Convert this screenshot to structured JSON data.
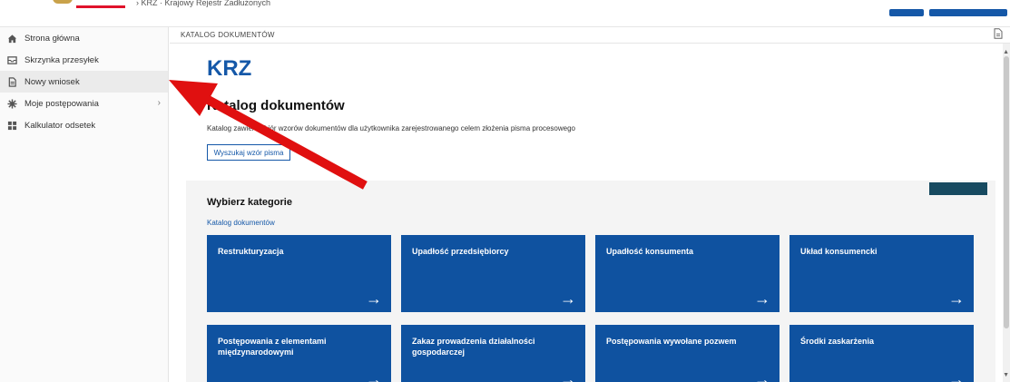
{
  "header": {
    "breadcrumb": "›  KRZ · Krajowy Rejestr Zadłużonych"
  },
  "sidebar": {
    "items": [
      {
        "label": "Strona główna",
        "icon": "home-icon"
      },
      {
        "label": "Skrzynka przesyłek",
        "icon": "inbox-icon"
      },
      {
        "label": "Nowy wniosek",
        "icon": "document-icon"
      },
      {
        "label": "Moje postępowania",
        "icon": "gear-icon"
      },
      {
        "label": "Kalkulator odsetek",
        "icon": "calculator-icon"
      }
    ]
  },
  "page": {
    "breadcrumb": "KATALOG DOKUMENTÓW",
    "brand": "KRZ",
    "title": "Katalog dokumentów",
    "description": "Katalog zawiera zbiór wzorów dokumentów dla użytkownika zarejestrowanego celem złożenia pisma procesowego",
    "search_button": "Wyszukaj wzór pisma"
  },
  "categories": {
    "title": "Wybierz kategorie",
    "link": "Katalog dokumentów",
    "tiles": [
      "Restrukturyzacja",
      "Upadłość przedsiębiorcy",
      "Upadłość konsumenta",
      "Układ konsumencki",
      "Postępowania z elementami międzynarodowymi",
      "Zakaz prowadzenia działalności gospodarczej",
      "Postępowania wywołane pozwem",
      "Środki zaskarżenia"
    ]
  },
  "colors": {
    "accent": "#1558a8",
    "tile": "#0f52a0",
    "annotation": "#e01010"
  }
}
